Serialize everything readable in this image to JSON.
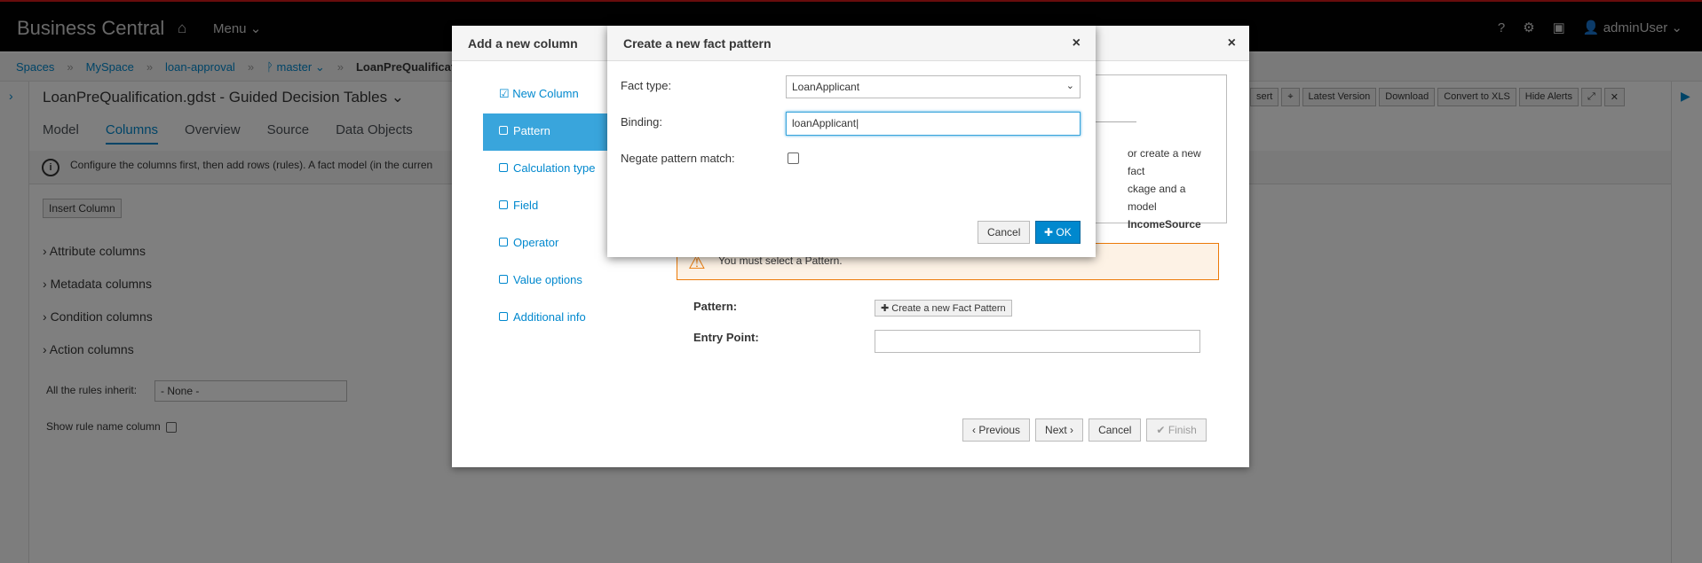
{
  "app": {
    "brand": "Business Central",
    "menu": "Menu",
    "user": "adminUser"
  },
  "breadcrumb": [
    "Spaces",
    "MySpace",
    "loan-approval",
    "master",
    "LoanPreQualification"
  ],
  "editor": {
    "title": "LoanPreQualification.gdst - Guided Decision Tables",
    "tabs": [
      "Model",
      "Columns",
      "Overview",
      "Source",
      "Data Objects"
    ],
    "active_tab": "Columns",
    "info": "Configure the columns first, then add rows (rules). A fact model (in the curren",
    "insert_button": "Insert Column",
    "sections": [
      "Attribute columns",
      "Metadata columns",
      "Condition columns",
      "Action columns"
    ],
    "inherit_label": "All the rules inherit:",
    "inherit_value": "- None -",
    "show_rule_name": "Show rule name column",
    "toolbar": [
      "sert",
      "",
      "Latest Version",
      "Download",
      "Convert to XLS",
      "Hide Alerts"
    ]
  },
  "wizard": {
    "title": "Add a new column",
    "steps": [
      "New Column",
      "Pattern",
      "Calculation type",
      "Field",
      "Operator",
      "Value options",
      "Additional info"
    ],
    "panel_text_1": "or create a new fact",
    "panel_text_2": "ckage and a model",
    "panel_text_3": "IncomeSource",
    "warning": "You must select a Pattern.",
    "pattern_label": "Pattern:",
    "create_pattern_button": "Create a new Fact Pattern",
    "entry_point_label": "Entry Point:",
    "previous": "Previous",
    "next": "Next",
    "cancel": "Cancel",
    "finish": "Finish"
  },
  "fact_dialog": {
    "title": "Create a new fact pattern",
    "fact_type_label": "Fact type:",
    "fact_type_value": "LoanApplicant",
    "binding_label": "Binding:",
    "binding_value": "loanApplicant",
    "negate_label": "Negate pattern match:",
    "cancel": "Cancel",
    "ok": "OK"
  }
}
